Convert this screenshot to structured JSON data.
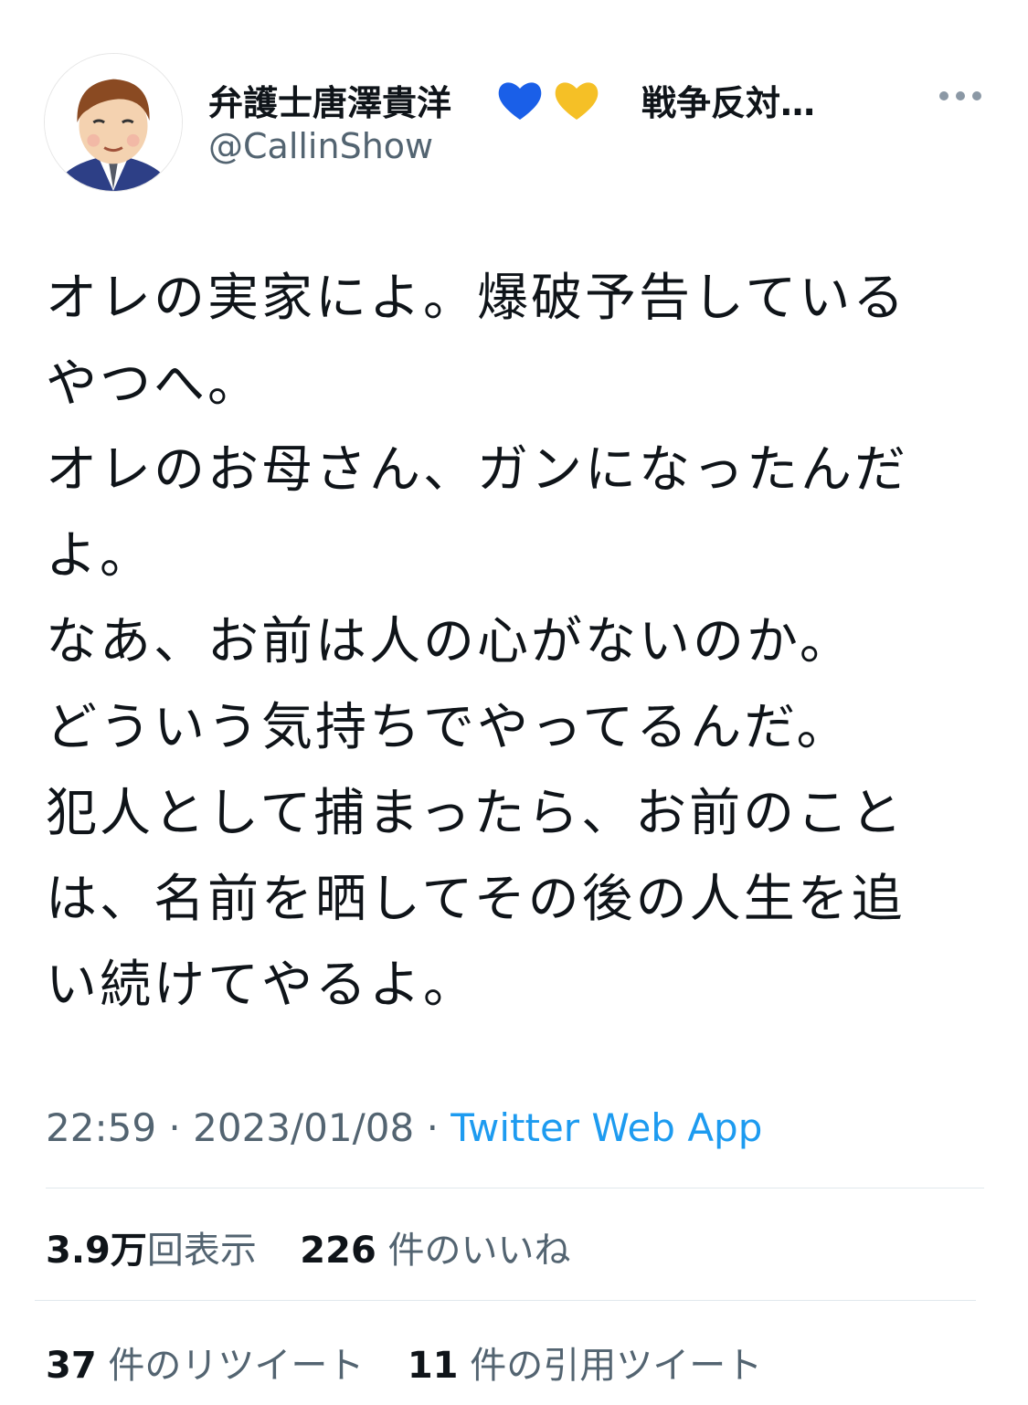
{
  "user": {
    "display_name": "弁護士唐澤貴洋",
    "display_name_suffix": "戦争反対…",
    "hearts": [
      "blue-heart-icon",
      "yellow-heart-icon"
    ],
    "handle": "@CallinShow"
  },
  "tweet": {
    "paragraphs": [
      "オレの実家によ。爆破予告している\nやつへ。\nオレのお母さん、ガンになったんだ\nよ。\nなあ、お前は人の心がないのか。\nどういう気持ちでやってるんだ。",
      "犯人として捕まったら、お前のこと\nは、名前を晒してその後の人生を追\nい続けてやるよ。"
    ],
    "time": "22:59",
    "date": "2023/01/08",
    "separator": "·",
    "source": "Twitter Web App"
  },
  "stats": {
    "views_num": "3.9",
    "views_unit": "万",
    "views_label": "回表示",
    "likes_num": "226",
    "likes_label": "件のいいね",
    "retweets_num": "37",
    "retweets_label": "件のリツイート",
    "quotes_num": "11",
    "quotes_label": "件の引用ツイート"
  },
  "colors": {
    "text": "#0f1419",
    "secondary": "#536471",
    "link": "#1d9bf0",
    "blue_heart": "#1a5fe8",
    "yellow_heart": "#f5c026"
  }
}
